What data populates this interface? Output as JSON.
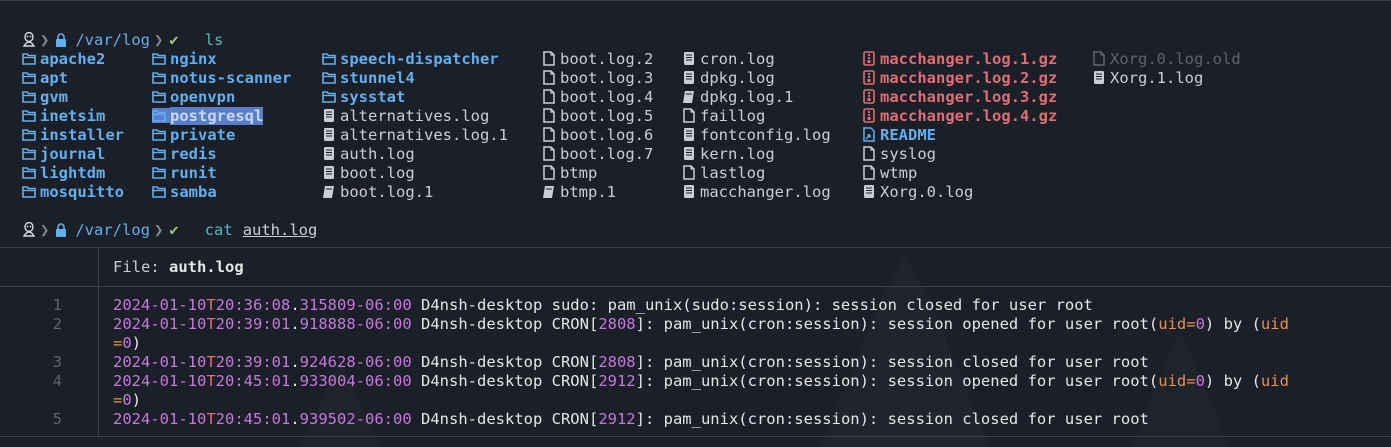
{
  "prompt1": {
    "path": "/var/log",
    "command": "ls"
  },
  "prompt2": {
    "path": "/var/log",
    "command": "cat",
    "argument": "auth.log"
  },
  "ls": {
    "col1": [
      {
        "name": "apache2",
        "kind": "dir"
      },
      {
        "name": "apt",
        "kind": "dir"
      },
      {
        "name": "gvm",
        "kind": "dir"
      },
      {
        "name": "inetsim",
        "kind": "dir"
      },
      {
        "name": "installer",
        "kind": "dir"
      },
      {
        "name": "journal",
        "kind": "dir"
      },
      {
        "name": "lightdm",
        "kind": "dir"
      },
      {
        "name": "mosquitto",
        "kind": "dir"
      }
    ],
    "col2": [
      {
        "name": "nginx",
        "kind": "dir"
      },
      {
        "name": "notus-scanner",
        "kind": "dir"
      },
      {
        "name": "openvpn",
        "kind": "dir"
      },
      {
        "name": "postgresql",
        "kind": "dir-selected"
      },
      {
        "name": "private",
        "kind": "dir"
      },
      {
        "name": "redis",
        "kind": "dir"
      },
      {
        "name": "runit",
        "kind": "dir"
      },
      {
        "name": "samba",
        "kind": "dir"
      }
    ],
    "col3": [
      {
        "name": "speech-dispatcher",
        "kind": "dir"
      },
      {
        "name": "stunnel4",
        "kind": "dir"
      },
      {
        "name": "sysstat",
        "kind": "dir"
      },
      {
        "name": "alternatives.log",
        "kind": "log"
      },
      {
        "name": "alternatives.log.1",
        "kind": "log"
      },
      {
        "name": "auth.log",
        "kind": "log"
      },
      {
        "name": "boot.log",
        "kind": "log"
      },
      {
        "name": "boot.log.1",
        "kind": "book"
      }
    ],
    "col4": [
      {
        "name": "boot.log.2",
        "kind": "file"
      },
      {
        "name": "boot.log.3",
        "kind": "file"
      },
      {
        "name": "boot.log.4",
        "kind": "file"
      },
      {
        "name": "boot.log.5",
        "kind": "file"
      },
      {
        "name": "boot.log.6",
        "kind": "file"
      },
      {
        "name": "boot.log.7",
        "kind": "file"
      },
      {
        "name": "btmp",
        "kind": "file"
      },
      {
        "name": "btmp.1",
        "kind": "book"
      }
    ],
    "col5": [
      {
        "name": "cron.log",
        "kind": "log"
      },
      {
        "name": "dpkg.log",
        "kind": "log"
      },
      {
        "name": "dpkg.log.1",
        "kind": "book"
      },
      {
        "name": "faillog",
        "kind": "file"
      },
      {
        "name": "fontconfig.log",
        "kind": "log"
      },
      {
        "name": "kern.log",
        "kind": "log"
      },
      {
        "name": "lastlog",
        "kind": "file"
      },
      {
        "name": "macchanger.log",
        "kind": "log"
      }
    ],
    "col6": [
      {
        "name": "macchanger.log.1.gz",
        "kind": "archive"
      },
      {
        "name": "macchanger.log.2.gz",
        "kind": "archive"
      },
      {
        "name": "macchanger.log.3.gz",
        "kind": "archive"
      },
      {
        "name": "macchanger.log.4.gz",
        "kind": "archive"
      },
      {
        "name": "README",
        "kind": "readme"
      },
      {
        "name": "syslog",
        "kind": "file"
      },
      {
        "name": "wtmp",
        "kind": "file"
      },
      {
        "name": "Xorg.0.log",
        "kind": "log"
      }
    ],
    "col7": [
      {
        "name": "Xorg.0.log.old",
        "kind": "dim"
      },
      {
        "name": "Xorg.1.log",
        "kind": "log"
      }
    ]
  },
  "bat": {
    "header_label": "File: ",
    "header_file": "auth.log",
    "line_numbers": [
      "1",
      "2",
      "3",
      "4",
      "5"
    ],
    "lines": [
      [
        [
          "2024-01-10",
          "ts"
        ],
        [
          "T",
          "tsep"
        ],
        [
          "20:36:08",
          "ts"
        ],
        [
          ".",
          "txt"
        ],
        [
          "315809",
          "ts"
        ],
        [
          "-06:00",
          "ts"
        ],
        [
          " D4nsh-desktop sudo: pam_unix(sudo:session): session closed for user root",
          "txt"
        ]
      ],
      [
        [
          "2024-01-10",
          "ts"
        ],
        [
          "T",
          "tsep"
        ],
        [
          "20:39:01",
          "ts"
        ],
        [
          ".",
          "txt"
        ],
        [
          "918888",
          "ts"
        ],
        [
          "-06:00",
          "ts"
        ],
        [
          " D4nsh-desktop CRON[",
          "txt"
        ],
        [
          "2808",
          "num"
        ],
        [
          "]: pam_unix(cron:session): session opened for user root(",
          "txt"
        ],
        [
          "uid=",
          "kw"
        ],
        [
          "0",
          "num"
        ],
        [
          ") by (",
          "txt"
        ],
        [
          "uid",
          "kw"
        ]
      ],
      [
        [
          "=",
          "kw"
        ],
        [
          "0",
          "num"
        ],
        [
          ")",
          "txt"
        ]
      ],
      [
        [
          "2024-01-10",
          "ts"
        ],
        [
          "T",
          "tsep"
        ],
        [
          "20:39:01",
          "ts"
        ],
        [
          ".",
          "txt"
        ],
        [
          "924628",
          "ts"
        ],
        [
          "-06:00",
          "ts"
        ],
        [
          " D4nsh-desktop CRON[",
          "txt"
        ],
        [
          "2808",
          "num"
        ],
        [
          "]: pam_unix(cron:session): session closed for user root",
          "txt"
        ]
      ],
      [
        [
          "2024-01-10",
          "ts"
        ],
        [
          "T",
          "tsep"
        ],
        [
          "20:45:01",
          "ts"
        ],
        [
          ".",
          "txt"
        ],
        [
          "933004",
          "ts"
        ],
        [
          "-06:00",
          "ts"
        ],
        [
          " D4nsh-desktop CRON[",
          "txt"
        ],
        [
          "2912",
          "num"
        ],
        [
          "]: pam_unix(cron:session): session opened for user root(",
          "txt"
        ],
        [
          "uid=",
          "kw"
        ],
        [
          "0",
          "num"
        ],
        [
          ") by (",
          "txt"
        ],
        [
          "uid",
          "kw"
        ]
      ],
      [
        [
          "=",
          "kw"
        ],
        [
          "0",
          "num"
        ],
        [
          ")",
          "txt"
        ]
      ],
      [
        [
          "2024-01-10",
          "ts"
        ],
        [
          "T",
          "tsep"
        ],
        [
          "20:45:01",
          "ts"
        ],
        [
          ".",
          "txt"
        ],
        [
          "939502",
          "ts"
        ],
        [
          "-06:00",
          "ts"
        ],
        [
          " D4nsh-desktop CRON[",
          "txt"
        ],
        [
          "2912",
          "num"
        ],
        [
          "]: pam_unix(cron:session): session closed for user root",
          "txt"
        ]
      ]
    ]
  },
  "colors": {
    "background": "#1b1f27",
    "directory": "#61afef",
    "archive": "#e06c75",
    "timestamp": "#c678dd",
    "keyword": "#e5904f"
  }
}
